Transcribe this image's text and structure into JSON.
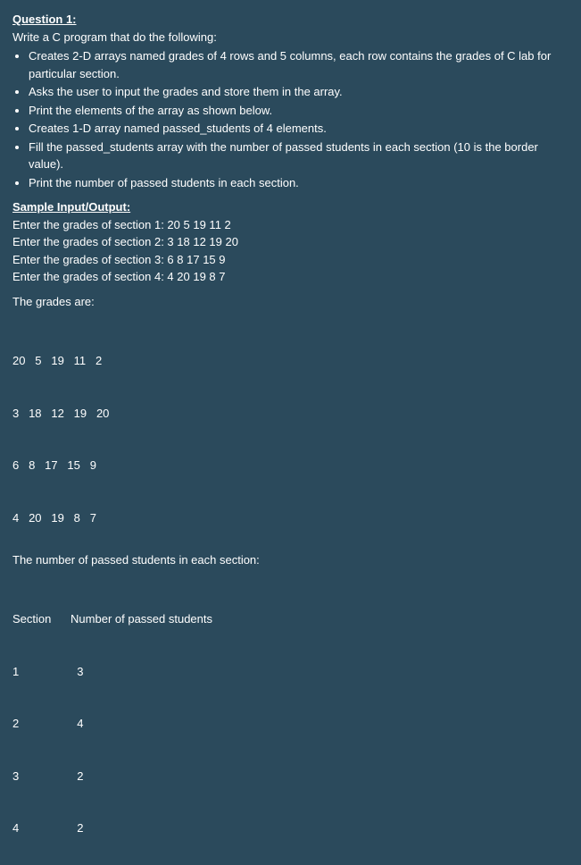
{
  "q": {
    "title": "Question 1:",
    "intro": "Write a C program that do the following:",
    "bullets": [
      "Creates 2-D arrays named grades of 4 rows and 5 columns, each row contains the grades of C lab for particular section.",
      "Asks the user to input the grades and store them in the array.",
      "Print the elements of the array as shown below.",
      "Creates 1-D array named passed_students of 4 elements.",
      "Fill the passed_students array with the number of passed students in each section (10 is the border value).",
      "Print the number of passed students in each section."
    ]
  },
  "io": {
    "heading": "Sample Input/Output:",
    "inputs": [
      "Enter the grades of section 1: 20  5  19  11  2",
      "Enter the grades of section 2: 3  18  12  19  20",
      "Enter the grades of section 3: 6  8  17  15  9",
      "Enter the grades of section 4: 4  20  19  8  7"
    ],
    "grades_label": "The grades are:",
    "grades_rows": [
      "20   5   19   11   2",
      "3   18   12   19   20",
      "6   8   17   15   9",
      "4   20   19   8   7"
    ],
    "passed_label": "The number of passed students in each section:",
    "passed_header": "Section      Number of passed students",
    "passed_rows": [
      "1                  3",
      "2                  4",
      "3                  2",
      "4                  2"
    ]
  },
  "chart_data": {
    "type": "table",
    "title": "Number of passed students per section",
    "columns": [
      "Section",
      "Number of passed students"
    ],
    "rows": [
      [
        1,
        3
      ],
      [
        2,
        4
      ],
      [
        3,
        2
      ],
      [
        4,
        2
      ]
    ],
    "grades_matrix": [
      [
        20,
        5,
        19,
        11,
        2
      ],
      [
        3,
        18,
        12,
        19,
        20
      ],
      [
        6,
        8,
        17,
        15,
        9
      ],
      [
        4,
        20,
        19,
        8,
        7
      ]
    ]
  }
}
